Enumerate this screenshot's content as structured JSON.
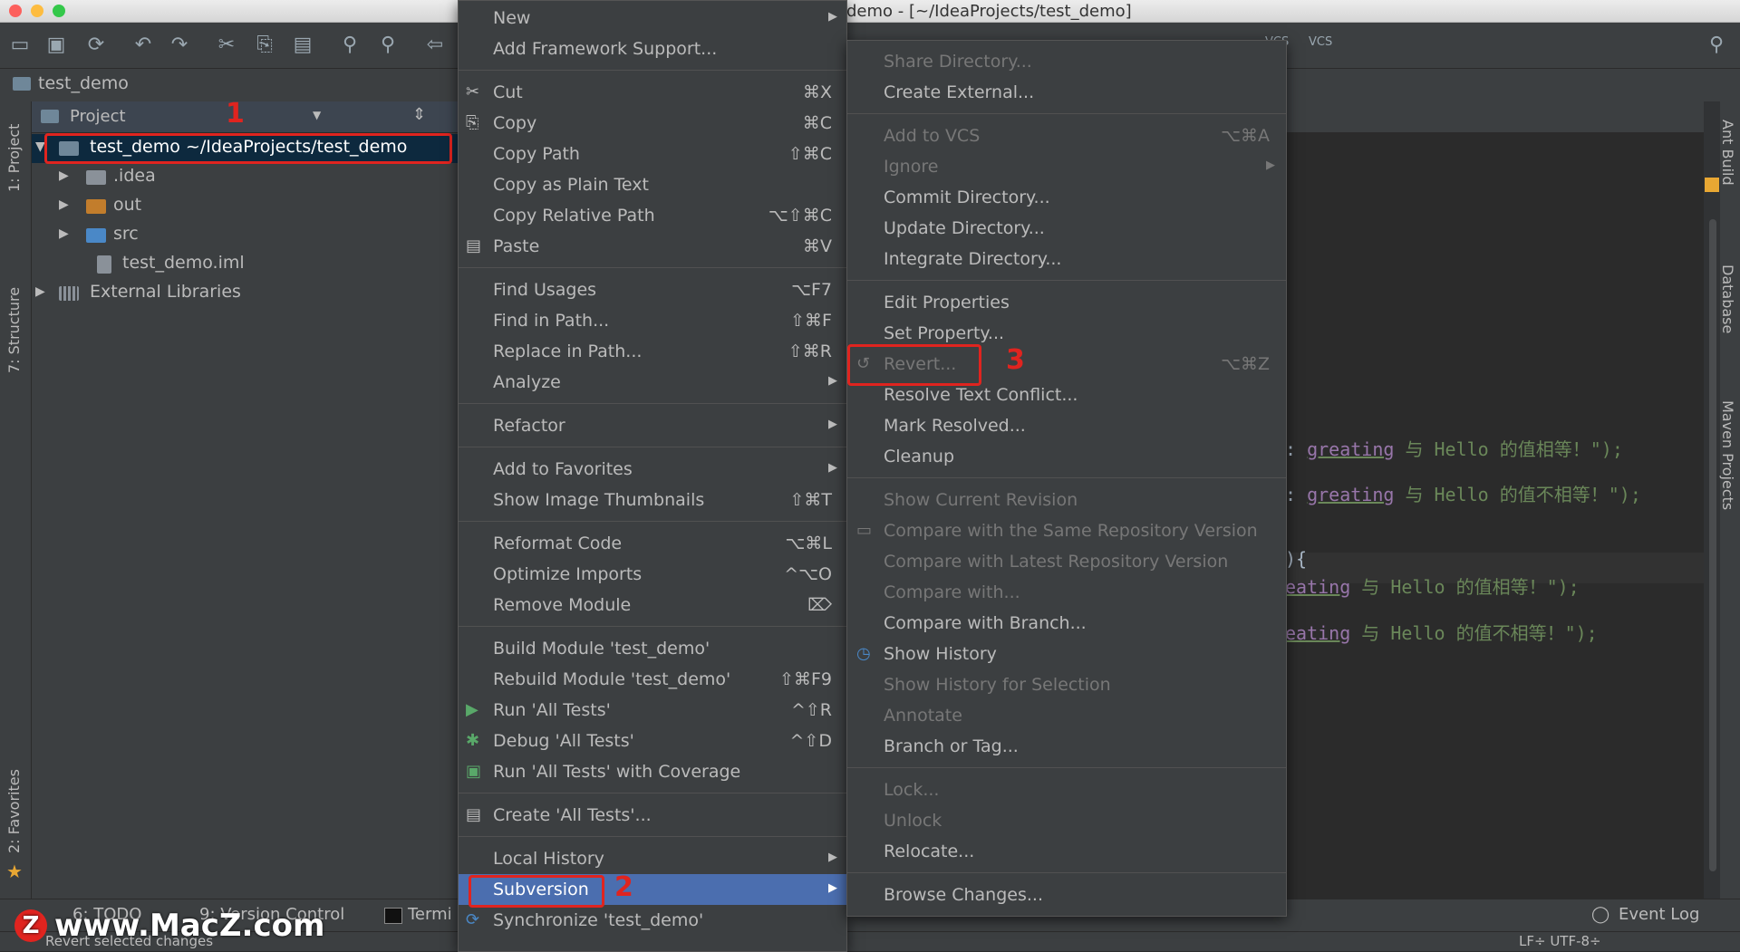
{
  "window": {
    "title": "demo - [~/IdeaProjects/test_demo]"
  },
  "toolbar": {
    "icons": [
      "open-icon",
      "save-icon",
      "sync-icon",
      "undo-icon",
      "redo-icon",
      "cut-icon",
      "copy-icon",
      "paste-icon",
      "find-icon",
      "replace-icon",
      "back-icon",
      "vcs-update-icon",
      "vcs-commit-icon",
      "search-icon"
    ],
    "vcs_label_1": "VCS",
    "vcs_label_2": "VCS"
  },
  "navbar": {
    "crumb": "test_demo"
  },
  "left_strip": {
    "tabs": [
      "1: Project",
      "7: Structure",
      "2: Favorites"
    ]
  },
  "project": {
    "title": "Project",
    "tree": [
      {
        "label": "test_demo  ~/IdeaProjects/test_demo",
        "level": 0,
        "expanded": true,
        "selected": true
      },
      {
        "label": ".idea",
        "level": 1
      },
      {
        "label": "out",
        "level": 1
      },
      {
        "label": "src",
        "level": 1
      },
      {
        "label": "test_demo.iml",
        "level": 2
      },
      {
        "label": "External Libraries",
        "level": 0
      }
    ]
  },
  "annotations": {
    "step1": "1",
    "step2": "2",
    "step3": "3"
  },
  "context_menu": {
    "items": [
      {
        "label": "New",
        "shortcut": "",
        "submenu": true
      },
      {
        "label": "Add Framework Support...",
        "shortcut": ""
      },
      {
        "label": "Cut",
        "shortcut": "⌘X",
        "icon": "✂"
      },
      {
        "label": "Copy",
        "shortcut": "⌘C",
        "icon": "⎘"
      },
      {
        "label": "Copy Path",
        "shortcut": "⇧⌘C"
      },
      {
        "label": "Copy as Plain Text",
        "shortcut": ""
      },
      {
        "label": "Copy Relative Path",
        "shortcut": "⌥⇧⌘C"
      },
      {
        "label": "Paste",
        "shortcut": "⌘V",
        "icon": "📋"
      },
      {
        "label": "Find Usages",
        "shortcut": "⌥F7"
      },
      {
        "label": "Find in Path...",
        "shortcut": "⇧⌘F"
      },
      {
        "label": "Replace in Path...",
        "shortcut": "⇧⌘R"
      },
      {
        "label": "Analyze",
        "shortcut": "",
        "submenu": true
      },
      {
        "label": "Refactor",
        "shortcut": "",
        "submenu": true
      },
      {
        "label": "Add to Favorites",
        "shortcut": "",
        "submenu": true
      },
      {
        "label": "Show Image Thumbnails",
        "shortcut": "⇧⌘T"
      },
      {
        "label": "Reformat Code",
        "shortcut": "⌥⌘L"
      },
      {
        "label": "Optimize Imports",
        "shortcut": "^⌥O"
      },
      {
        "label": "Remove Module",
        "shortcut": "⌦"
      },
      {
        "label": "Build Module 'test_demo'",
        "shortcut": ""
      },
      {
        "label": "Rebuild Module 'test_demo'",
        "shortcut": "⇧⌘F9"
      },
      {
        "label": "Run 'All Tests'",
        "shortcut": "^⇧R",
        "icon": "▶"
      },
      {
        "label": "Debug 'All Tests'",
        "shortcut": "^⇧D",
        "icon": "✱"
      },
      {
        "label": "Run 'All Tests' with Coverage",
        "shortcut": "",
        "icon": "▣"
      },
      {
        "label": "Create 'All Tests'...",
        "shortcut": "",
        "icon": "▤"
      },
      {
        "label": "Local History",
        "shortcut": "",
        "submenu": true
      },
      {
        "label": "Subversion",
        "shortcut": "",
        "submenu": true,
        "selected": true
      },
      {
        "label": "Synchronize 'test_demo'",
        "shortcut": "",
        "icon": "⟳"
      }
    ]
  },
  "subversion_menu": {
    "items": [
      {
        "label": "Share Directory...",
        "disabled": true
      },
      {
        "label": "Create External..."
      },
      {
        "label": "Add to VCS",
        "shortcut": "⌥⌘A",
        "disabled": true
      },
      {
        "label": "Ignore",
        "disabled": true,
        "submenu": true
      },
      {
        "label": "Commit Directory..."
      },
      {
        "label": "Update Directory..."
      },
      {
        "label": "Integrate Directory..."
      },
      {
        "label": "Edit Properties"
      },
      {
        "label": "Set Property..."
      },
      {
        "label": "Revert...",
        "shortcut": "⌥⌘Z",
        "disabled": true,
        "icon": "↺"
      },
      {
        "label": "Resolve Text Conflict..."
      },
      {
        "label": "Mark Resolved..."
      },
      {
        "label": "Cleanup"
      },
      {
        "label": "Show Current Revision",
        "disabled": true
      },
      {
        "label": "Compare with the Same Repository Version",
        "disabled": true
      },
      {
        "label": "Compare with Latest Repository Version",
        "disabled": true
      },
      {
        "label": "Compare with...",
        "disabled": true
      },
      {
        "label": "Compare with Branch..."
      },
      {
        "label": "Show History",
        "icon": "◷"
      },
      {
        "label": "Show History for Selection",
        "disabled": true
      },
      {
        "label": "Annotate",
        "disabled": true
      },
      {
        "label": "Branch or Tag..."
      },
      {
        "label": "Lock...",
        "disabled": true
      },
      {
        "label": "Unlock",
        "disabled": true
      },
      {
        "label": "Relocate..."
      },
      {
        "label": "Browse Changes..."
      }
    ]
  },
  "editor": {
    "lines": [
      {
        "prefix": ": ",
        "var": "greating",
        "rest": " 与 Hello 的值相等！\");"
      },
      {
        "prefix": ": ",
        "var": "greating",
        "rest": " 与 Hello 的值不相等！\");"
      },
      {
        "prefix": "){",
        "var": "",
        "rest": ""
      },
      {
        "prefix": "",
        "var": "eating",
        "rest": " 与 Hello 的值相等！\");"
      },
      {
        "prefix": "",
        "var": "eating",
        "rest": " 与 Hello 的值不相等！\");"
      }
    ]
  },
  "right_strip": {
    "tabs": [
      "Ant Build",
      "Database",
      "Maven Projects"
    ]
  },
  "bottom_bar": {
    "tabs": [
      "6: TODO",
      "9: Version Control",
      "Termi"
    ],
    "event_log": "Event Log"
  },
  "status_bar": {
    "message": "Revert selected changes",
    "encoding": "LF÷  UTF-8÷"
  },
  "watermark": {
    "logo": "Z",
    "text": "www.MacZ.com"
  },
  "colors": {
    "selection": "#4b6eaf",
    "annotation": "#e0241f",
    "menu_bg": "#3c3f41"
  }
}
